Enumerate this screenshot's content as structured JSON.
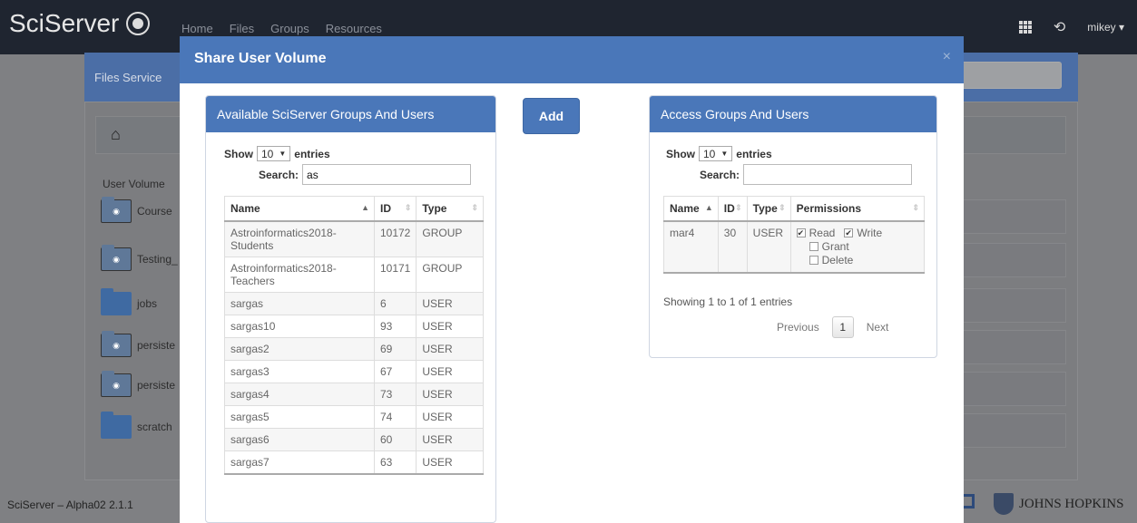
{
  "app": {
    "brand": "SciServer"
  },
  "navbar": {
    "links": [
      "Home",
      "Files",
      "Groups",
      "Resources"
    ],
    "user": "mikey ▾"
  },
  "background": {
    "panel_title": "Files Service",
    "user_volume_label": "User Volume",
    "rows": [
      {
        "label": "Course",
        "shared": true
      },
      {
        "label": "Testing_",
        "shared": true
      },
      {
        "label": "jobs",
        "shared": false
      },
      {
        "label": "persiste",
        "shared": true
      },
      {
        "label": "persiste",
        "shared": true
      },
      {
        "label": "scratch",
        "shared": false
      }
    ],
    "footer_version": "SciServer – Alpha02 2.1.1",
    "footer_logo": "JOHNS HOPKINS"
  },
  "modal": {
    "title": "Share User Volume",
    "close": "×",
    "add_button": "Add",
    "available": {
      "title": "Available SciServer Groups And Users",
      "show_label": "Show",
      "entries_label": "entries",
      "page_size": "10",
      "search_label": "Search:",
      "search_value": "as",
      "columns": [
        "Name",
        "ID",
        "Type"
      ],
      "rows": [
        {
          "name": "Astroinformatics2018-Students",
          "id": "10172",
          "type": "GROUP"
        },
        {
          "name": "Astroinformatics2018-Teachers",
          "id": "10171",
          "type": "GROUP"
        },
        {
          "name": "sargas",
          "id": "6",
          "type": "USER"
        },
        {
          "name": "sargas10",
          "id": "93",
          "type": "USER"
        },
        {
          "name": "sargas2",
          "id": "69",
          "type": "USER"
        },
        {
          "name": "sargas3",
          "id": "67",
          "type": "USER"
        },
        {
          "name": "sargas4",
          "id": "73",
          "type": "USER"
        },
        {
          "name": "sargas5",
          "id": "74",
          "type": "USER"
        },
        {
          "name": "sargas6",
          "id": "60",
          "type": "USER"
        },
        {
          "name": "sargas7",
          "id": "63",
          "type": "USER"
        }
      ]
    },
    "access": {
      "title": "Access Groups And Users",
      "show_label": "Show",
      "entries_label": "entries",
      "page_size": "10",
      "search_label": "Search:",
      "search_value": "",
      "columns": [
        "Name",
        "ID",
        "Type",
        "Permissions"
      ],
      "rows": [
        {
          "name": "mar4",
          "id": "30",
          "type": "USER",
          "permissions": {
            "read": "Read",
            "write": "Write",
            "grant": "Grant",
            "delete": "Delete"
          }
        }
      ],
      "info": "Showing 1 to 1 of 1 entries",
      "pager": {
        "previous": "Previous",
        "current": "1",
        "next": "Next"
      }
    }
  }
}
